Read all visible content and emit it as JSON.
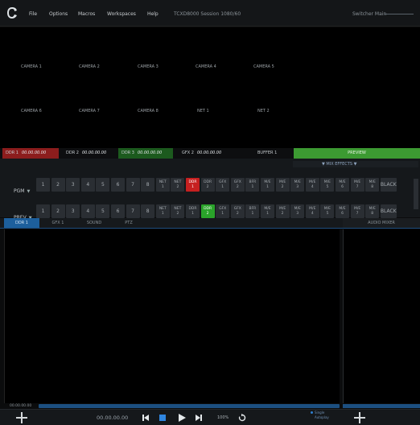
{
  "menubar": {
    "items": [
      "File",
      "Options",
      "Macros",
      "Workspaces",
      "Help"
    ],
    "session": "TCXD8000 Session  1080/60",
    "switcher_main": "Switcher Main"
  },
  "multiview": {
    "labels": [
      "CAMERA 1",
      "CAMERA 2",
      "CAMERA 3",
      "CAMERA 4",
      "CAMERA 5",
      "CAMERA 6",
      "CAMERA 7",
      "CAMERA 8",
      "NET 1",
      "NET 2"
    ]
  },
  "sources": {
    "ddr1": {
      "name": "DDR 1",
      "tc": "00.00.00.00"
    },
    "ddr2": {
      "name": "DDR 2",
      "tc": "00.00.00.00"
    },
    "ddr3": {
      "name": "DDR 3",
      "tc": "00.00.00.00"
    },
    "gfx2": {
      "name": "GFX 2",
      "tc": "00.00.00.00"
    },
    "buffer": "BUFFER 1",
    "preview": "PREVIEW"
  },
  "switcher": {
    "mix_effects": "▼  MIX EFFECTS  ▼",
    "pgm_label": "PGM",
    "prev_label": "PREV",
    "caret": "▼",
    "buttons": [
      {
        "l1": "1",
        "l2": ""
      },
      {
        "l1": "2",
        "l2": ""
      },
      {
        "l1": "3",
        "l2": ""
      },
      {
        "l1": "4",
        "l2": ""
      },
      {
        "l1": "5",
        "l2": ""
      },
      {
        "l1": "6",
        "l2": ""
      },
      {
        "l1": "7",
        "l2": ""
      },
      {
        "l1": "8",
        "l2": ""
      },
      {
        "l1": "NET",
        "l2": "1"
      },
      {
        "l1": "NET",
        "l2": "2"
      },
      {
        "l1": "DDR",
        "l2": "1"
      },
      {
        "l1": "DDR",
        "l2": "2"
      },
      {
        "l1": "GFX",
        "l2": "1"
      },
      {
        "l1": "GFX",
        "l2": "2"
      },
      {
        "l1": "BFR",
        "l2": "1"
      },
      {
        "l1": "M/E",
        "l2": "1"
      },
      {
        "l1": "M/E",
        "l2": "2"
      },
      {
        "l1": "M/E",
        "l2": "3"
      },
      {
        "l1": "M/E",
        "l2": "4"
      },
      {
        "l1": "M/E",
        "l2": "5"
      },
      {
        "l1": "M/E",
        "l2": "6"
      },
      {
        "l1": "M/E",
        "l2": "7"
      },
      {
        "l1": "M/E",
        "l2": "8"
      },
      {
        "l1": "BLACK",
        "l2": ""
      }
    ],
    "pgm_selected": "DDR 1",
    "prev_selected": "DDR 2",
    "colors": {
      "pgm": "#c62020",
      "prev": "#2aa32a"
    }
  },
  "tabs": [
    "DDR 1",
    "GFX 1",
    "SOUND",
    "PTZ"
  ],
  "active_tab": "DDR 1",
  "audio_mixer": "AUDIO MIXER",
  "panel_timecode": "00.00.00.00",
  "transport": {
    "timecode": "00.00.00.00",
    "zoom": "100%",
    "single": "Single",
    "autoplay": "Autoplay"
  },
  "accent": "#1d5f9c"
}
